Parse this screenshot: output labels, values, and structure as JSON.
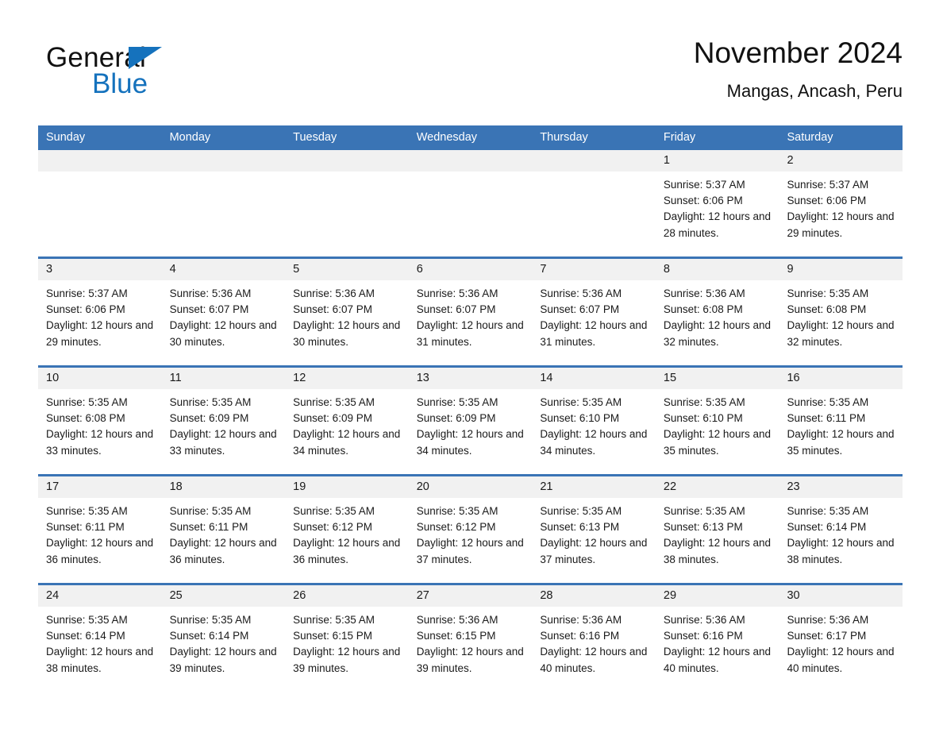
{
  "brand": {
    "word_one": "General",
    "word_two": "Blue",
    "triangle_color": "#1572bd"
  },
  "header": {
    "title": "November 2024",
    "subtitle": "Mangas, Ancash, Peru"
  },
  "theme": {
    "header_blue": "#3a74b5",
    "date_band": "#f1f1f1",
    "text": "#1a1a1a"
  },
  "weekdays": [
    "Sunday",
    "Monday",
    "Tuesday",
    "Wednesday",
    "Thursday",
    "Friday",
    "Saturday"
  ],
  "weeks": [
    {
      "days": [
        {
          "num": "",
          "empty": true
        },
        {
          "num": "",
          "empty": true
        },
        {
          "num": "",
          "empty": true
        },
        {
          "num": "",
          "empty": true
        },
        {
          "num": "",
          "empty": true
        },
        {
          "num": "1",
          "sunrise": "Sunrise: 5:37 AM",
          "sunset": "Sunset: 6:06 PM",
          "daylight": "Daylight: 12 hours and 28 minutes."
        },
        {
          "num": "2",
          "sunrise": "Sunrise: 5:37 AM",
          "sunset": "Sunset: 6:06 PM",
          "daylight": "Daylight: 12 hours and 29 minutes."
        }
      ]
    },
    {
      "days": [
        {
          "num": "3",
          "sunrise": "Sunrise: 5:37 AM",
          "sunset": "Sunset: 6:06 PM",
          "daylight": "Daylight: 12 hours and 29 minutes."
        },
        {
          "num": "4",
          "sunrise": "Sunrise: 5:36 AM",
          "sunset": "Sunset: 6:07 PM",
          "daylight": "Daylight: 12 hours and 30 minutes."
        },
        {
          "num": "5",
          "sunrise": "Sunrise: 5:36 AM",
          "sunset": "Sunset: 6:07 PM",
          "daylight": "Daylight: 12 hours and 30 minutes."
        },
        {
          "num": "6",
          "sunrise": "Sunrise: 5:36 AM",
          "sunset": "Sunset: 6:07 PM",
          "daylight": "Daylight: 12 hours and 31 minutes."
        },
        {
          "num": "7",
          "sunrise": "Sunrise: 5:36 AM",
          "sunset": "Sunset: 6:07 PM",
          "daylight": "Daylight: 12 hours and 31 minutes."
        },
        {
          "num": "8",
          "sunrise": "Sunrise: 5:36 AM",
          "sunset": "Sunset: 6:08 PM",
          "daylight": "Daylight: 12 hours and 32 minutes."
        },
        {
          "num": "9",
          "sunrise": "Sunrise: 5:35 AM",
          "sunset": "Sunset: 6:08 PM",
          "daylight": "Daylight: 12 hours and 32 minutes."
        }
      ]
    },
    {
      "days": [
        {
          "num": "10",
          "sunrise": "Sunrise: 5:35 AM",
          "sunset": "Sunset: 6:08 PM",
          "daylight": "Daylight: 12 hours and 33 minutes."
        },
        {
          "num": "11",
          "sunrise": "Sunrise: 5:35 AM",
          "sunset": "Sunset: 6:09 PM",
          "daylight": "Daylight: 12 hours and 33 minutes."
        },
        {
          "num": "12",
          "sunrise": "Sunrise: 5:35 AM",
          "sunset": "Sunset: 6:09 PM",
          "daylight": "Daylight: 12 hours and 34 minutes."
        },
        {
          "num": "13",
          "sunrise": "Sunrise: 5:35 AM",
          "sunset": "Sunset: 6:09 PM",
          "daylight": "Daylight: 12 hours and 34 minutes."
        },
        {
          "num": "14",
          "sunrise": "Sunrise: 5:35 AM",
          "sunset": "Sunset: 6:10 PM",
          "daylight": "Daylight: 12 hours and 34 minutes."
        },
        {
          "num": "15",
          "sunrise": "Sunrise: 5:35 AM",
          "sunset": "Sunset: 6:10 PM",
          "daylight": "Daylight: 12 hours and 35 minutes."
        },
        {
          "num": "16",
          "sunrise": "Sunrise: 5:35 AM",
          "sunset": "Sunset: 6:11 PM",
          "daylight": "Daylight: 12 hours and 35 minutes."
        }
      ]
    },
    {
      "days": [
        {
          "num": "17",
          "sunrise": "Sunrise: 5:35 AM",
          "sunset": "Sunset: 6:11 PM",
          "daylight": "Daylight: 12 hours and 36 minutes."
        },
        {
          "num": "18",
          "sunrise": "Sunrise: 5:35 AM",
          "sunset": "Sunset: 6:11 PM",
          "daylight": "Daylight: 12 hours and 36 minutes."
        },
        {
          "num": "19",
          "sunrise": "Sunrise: 5:35 AM",
          "sunset": "Sunset: 6:12 PM",
          "daylight": "Daylight: 12 hours and 36 minutes."
        },
        {
          "num": "20",
          "sunrise": "Sunrise: 5:35 AM",
          "sunset": "Sunset: 6:12 PM",
          "daylight": "Daylight: 12 hours and 37 minutes."
        },
        {
          "num": "21",
          "sunrise": "Sunrise: 5:35 AM",
          "sunset": "Sunset: 6:13 PM",
          "daylight": "Daylight: 12 hours and 37 minutes."
        },
        {
          "num": "22",
          "sunrise": "Sunrise: 5:35 AM",
          "sunset": "Sunset: 6:13 PM",
          "daylight": "Daylight: 12 hours and 38 minutes."
        },
        {
          "num": "23",
          "sunrise": "Sunrise: 5:35 AM",
          "sunset": "Sunset: 6:14 PM",
          "daylight": "Daylight: 12 hours and 38 minutes."
        }
      ]
    },
    {
      "days": [
        {
          "num": "24",
          "sunrise": "Sunrise: 5:35 AM",
          "sunset": "Sunset: 6:14 PM",
          "daylight": "Daylight: 12 hours and 38 minutes."
        },
        {
          "num": "25",
          "sunrise": "Sunrise: 5:35 AM",
          "sunset": "Sunset: 6:14 PM",
          "daylight": "Daylight: 12 hours and 39 minutes."
        },
        {
          "num": "26",
          "sunrise": "Sunrise: 5:35 AM",
          "sunset": "Sunset: 6:15 PM",
          "daylight": "Daylight: 12 hours and 39 minutes."
        },
        {
          "num": "27",
          "sunrise": "Sunrise: 5:36 AM",
          "sunset": "Sunset: 6:15 PM",
          "daylight": "Daylight: 12 hours and 39 minutes."
        },
        {
          "num": "28",
          "sunrise": "Sunrise: 5:36 AM",
          "sunset": "Sunset: 6:16 PM",
          "daylight": "Daylight: 12 hours and 40 minutes."
        },
        {
          "num": "29",
          "sunrise": "Sunrise: 5:36 AM",
          "sunset": "Sunset: 6:16 PM",
          "daylight": "Daylight: 12 hours and 40 minutes."
        },
        {
          "num": "30",
          "sunrise": "Sunrise: 5:36 AM",
          "sunset": "Sunset: 6:17 PM",
          "daylight": "Daylight: 12 hours and 40 minutes."
        }
      ]
    }
  ]
}
